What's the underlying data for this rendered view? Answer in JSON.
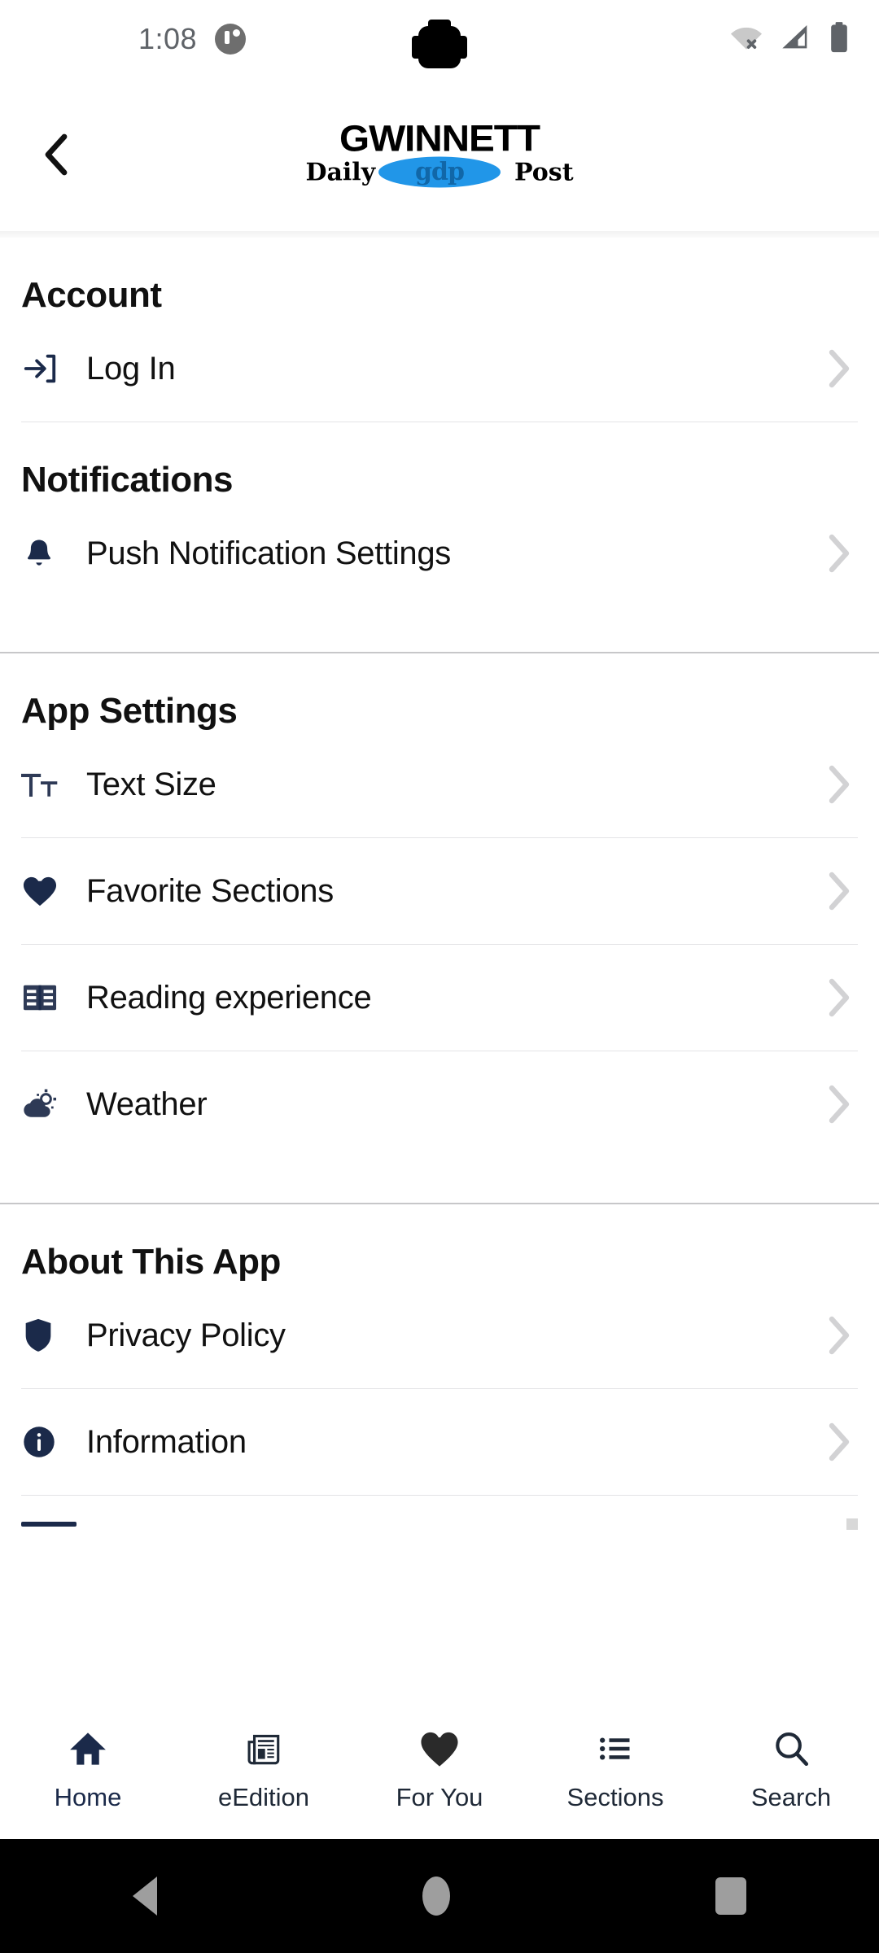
{
  "statusbar": {
    "time": "1:08",
    "notification_icon": "notification-badge-icon",
    "wifi_icon": "wifi-off-icon",
    "cellular_icon": "cellular-signal-icon",
    "battery_icon": "battery-full-icon"
  },
  "header": {
    "back_icon": "chevron-left-icon",
    "logo_top": "GWINNETT",
    "logo_script_left": "Daily",
    "logo_script_right": "Post",
    "logo_badge": "gdp",
    "brand_blue": "#2196e8",
    "brand_navy": "#1b2a4a"
  },
  "sections": [
    {
      "title": "Account",
      "rows": [
        {
          "label": "Log In",
          "icon": "login-icon"
        }
      ]
    },
    {
      "title": "Notifications",
      "rows": [
        {
          "label": "Push Notification Settings",
          "icon": "bell-icon"
        }
      ]
    },
    {
      "title": "App Settings",
      "rows": [
        {
          "label": "Text Size",
          "icon": "text-size-icon"
        },
        {
          "label": "Favorite Sections",
          "icon": "heart-icon"
        },
        {
          "label": "Reading experience",
          "icon": "article-book-icon"
        },
        {
          "label": "Weather",
          "icon": "partly-cloudy-icon"
        }
      ]
    },
    {
      "title": "About This App",
      "rows": [
        {
          "label": "Privacy Policy",
          "icon": "shield-icon"
        },
        {
          "label": "Information",
          "icon": "info-circle-icon"
        }
      ]
    }
  ],
  "tabbar": [
    {
      "label": "Home",
      "icon": "home-icon",
      "active": true
    },
    {
      "label": "eEdition",
      "icon": "newspaper-icon",
      "active": false
    },
    {
      "label": "For You",
      "icon": "heart-icon",
      "active": false
    },
    {
      "label": "Sections",
      "icon": "list-icon",
      "active": false
    },
    {
      "label": "Search",
      "icon": "search-icon",
      "active": false
    }
  ],
  "androidnav": {
    "back": "android-back-icon",
    "home": "android-home-icon",
    "recents": "android-recents-icon"
  }
}
